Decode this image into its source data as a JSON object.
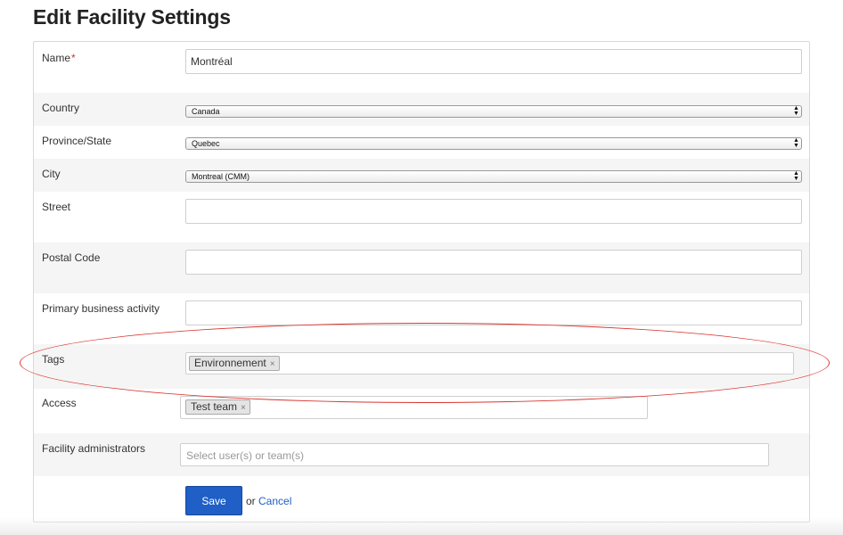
{
  "page": {
    "title": "Edit Facility Settings"
  },
  "form": {
    "name": {
      "label": "Name",
      "required_mark": "*",
      "value": "Montréal"
    },
    "country": {
      "label": "Country",
      "value": "Canada"
    },
    "province": {
      "label": "Province/State",
      "value": "Quebec"
    },
    "city": {
      "label": "City",
      "value": "Montreal (CMM)"
    },
    "street": {
      "label": "Street",
      "value": ""
    },
    "postal_code": {
      "label": "Postal Code",
      "value": ""
    },
    "primary_activity": {
      "label": "Primary business activity",
      "value": ""
    },
    "tags": {
      "label": "Tags",
      "chips": [
        "Environnement"
      ],
      "remove_glyph": "×"
    },
    "access": {
      "label": "Access",
      "chips": [
        "Test team"
      ],
      "remove_glyph": "×"
    },
    "administrators": {
      "label": "Facility administrators",
      "placeholder": "Select user(s) or team(s)"
    },
    "actions": {
      "save_label": "Save",
      "or_text": "or",
      "cancel_label": "Cancel"
    }
  },
  "annotation": {
    "shape": "ellipse",
    "highlights": "tags",
    "color": "#d9352f"
  },
  "colors": {
    "primary_button": "#1f5fc6",
    "required": "#d9322a",
    "shaded_row": "#f5f5f5"
  }
}
